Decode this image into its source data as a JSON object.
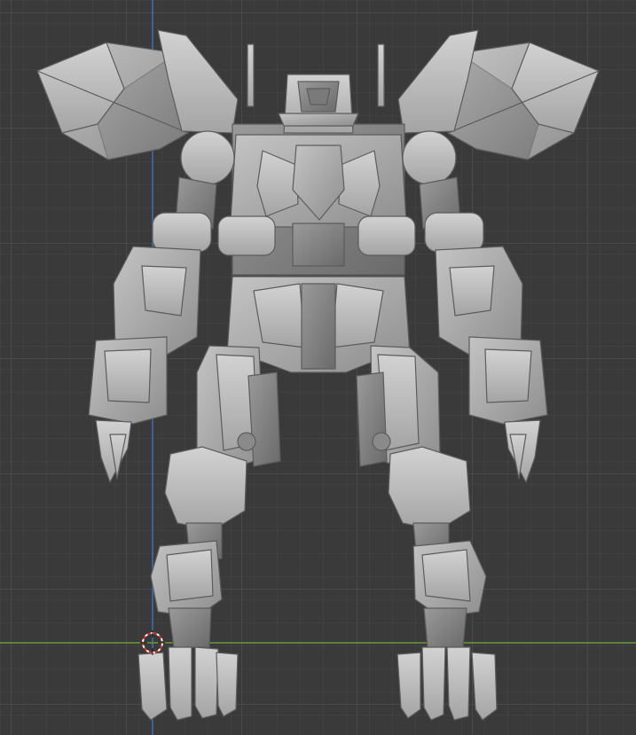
{
  "viewport": {
    "background": "#3a3a3a",
    "grid_color": "#4a4a4a",
    "x_axis_color": "#6a9a3c",
    "z_axis_color": "#3d6fb5",
    "model_base_color": "#a8a8a8",
    "model_edge_color": "#5c5c5c"
  },
  "objects": {
    "model": "mecha-model",
    "cursor": "3d-cursor-icon"
  }
}
